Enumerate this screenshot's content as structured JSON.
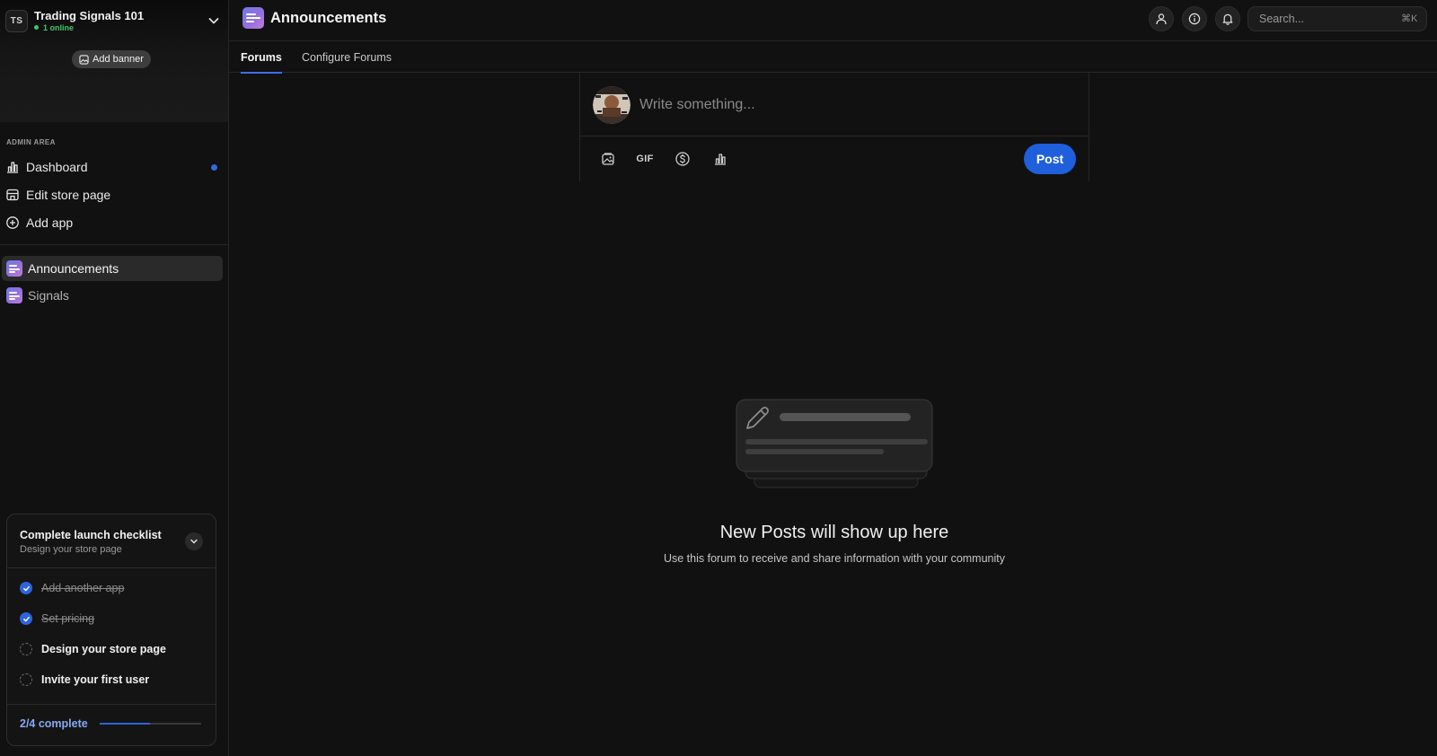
{
  "workspace": {
    "initials": "TS",
    "name": "Trading Signals 101",
    "online": "1 online",
    "add_banner_label": "Add banner"
  },
  "sidebar": {
    "admin_label": "ADMIN AREA",
    "admin_items": [
      {
        "label": "Dashboard",
        "icon": "bar-chart-icon",
        "has_dot": true
      },
      {
        "label": "Edit store page",
        "icon": "store-icon"
      },
      {
        "label": "Add app",
        "icon": "plus-circle-icon"
      }
    ],
    "apps": [
      {
        "label": "Announcements",
        "active": true
      },
      {
        "label": "Signals",
        "active": false
      }
    ]
  },
  "checklist": {
    "title": "Complete launch checklist",
    "subtitle": "Design your store page",
    "items": [
      {
        "label": "Add another app",
        "done": true
      },
      {
        "label": "Set pricing",
        "done": true
      },
      {
        "label": "Design your store page",
        "done": false
      },
      {
        "label": "Invite your first user",
        "done": false
      }
    ],
    "progress_label": "2/4 complete",
    "progress_fraction": 0.5
  },
  "header": {
    "title": "Announcements",
    "search_placeholder": "Search...",
    "search_shortcut": "⌘K"
  },
  "tabs": [
    {
      "label": "Forums",
      "active": true
    },
    {
      "label": "Configure Forums",
      "active": false
    }
  ],
  "composer": {
    "placeholder": "Write something...",
    "gif_label": "GIF",
    "post_label": "Post"
  },
  "empty_state": {
    "title": "New Posts will show up here",
    "subtitle": "Use this forum to receive and share information with your community"
  },
  "colors": {
    "background": "#111111",
    "accent": "#1f5fdc",
    "online": "#46c46b"
  }
}
